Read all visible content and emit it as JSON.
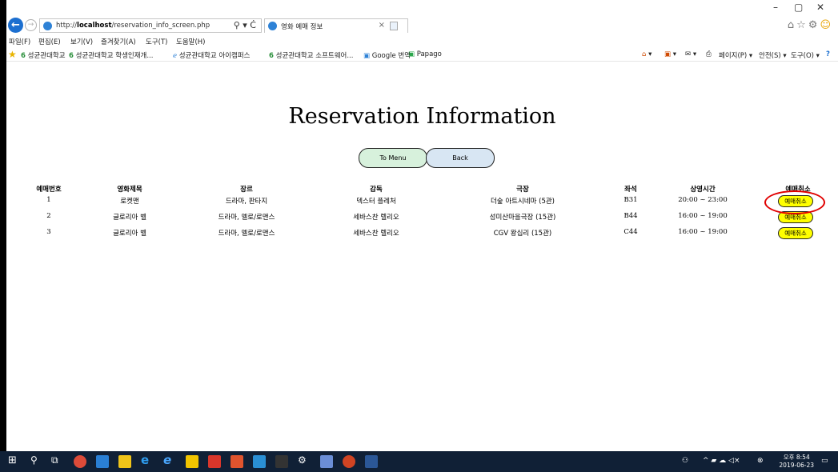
{
  "browser": {
    "url_prefix": "http://",
    "url_host": "localhost",
    "url_path": "/reservation_info_screen.php",
    "tab_title": "영화 예매 정보",
    "tab_close": "×",
    "address_tools": "⚲ ▾ Ċ",
    "right_tools": "⌂☆⚙",
    "smile": "☺",
    "min": "–",
    "max": "▢",
    "close": "✕"
  },
  "menubar": {
    "items": [
      "파일(F)",
      "편집(E)",
      "보기(V)",
      "즐겨찾기(A)",
      "도구(T)",
      "도움말(H)"
    ]
  },
  "favorites": {
    "items": [
      "성균관대학교",
      "성균관대학교 학생인재개...",
      "성균관대학교 아이캠퍼스",
      "성균관대학교 소프트웨어...",
      "Google 번역",
      "Papago"
    ],
    "commands": [
      "▾",
      "▾",
      "▾",
      "페이지(P) ▾",
      "안전(S) ▾",
      "도구(O) ▾"
    ]
  },
  "page": {
    "title": "Reservation Information",
    "to_menu": "To Menu",
    "back": "Back",
    "headers": [
      "예매번호",
      "영화제목",
      "장르",
      "감독",
      "극장",
      "좌석",
      "상영시간",
      "예매취소"
    ],
    "rows": [
      {
        "no": "1",
        "movie": "로켓맨",
        "genre": "드라마, 판타지",
        "director": "덱스터 플레처",
        "theater": "더숲 아트시네마 (5관)",
        "seat": "B31",
        "time": "20:00 ~ 23:00",
        "cancel": "예매취소"
      },
      {
        "no": "2",
        "movie": "글로리아 벨",
        "genre": "드라마, 멜로/로맨스",
        "director": "세바스찬 렐리오",
        "theater": "성미산마을극장 (15관)",
        "seat": "B44",
        "time": "16:00 ~ 19:00",
        "cancel": "예매취소"
      },
      {
        "no": "3",
        "movie": "글로리아 벨",
        "genre": "드라마, 멜로/로맨스",
        "director": "세바스찬 렐리오",
        "theater": "CGV 왕십리 (15관)",
        "seat": "C44",
        "time": "16:00 ~ 19:00",
        "cancel": "예매취소"
      }
    ]
  },
  "taskbar": {
    "time": "오후 8:54",
    "date": "2019-06-23"
  }
}
